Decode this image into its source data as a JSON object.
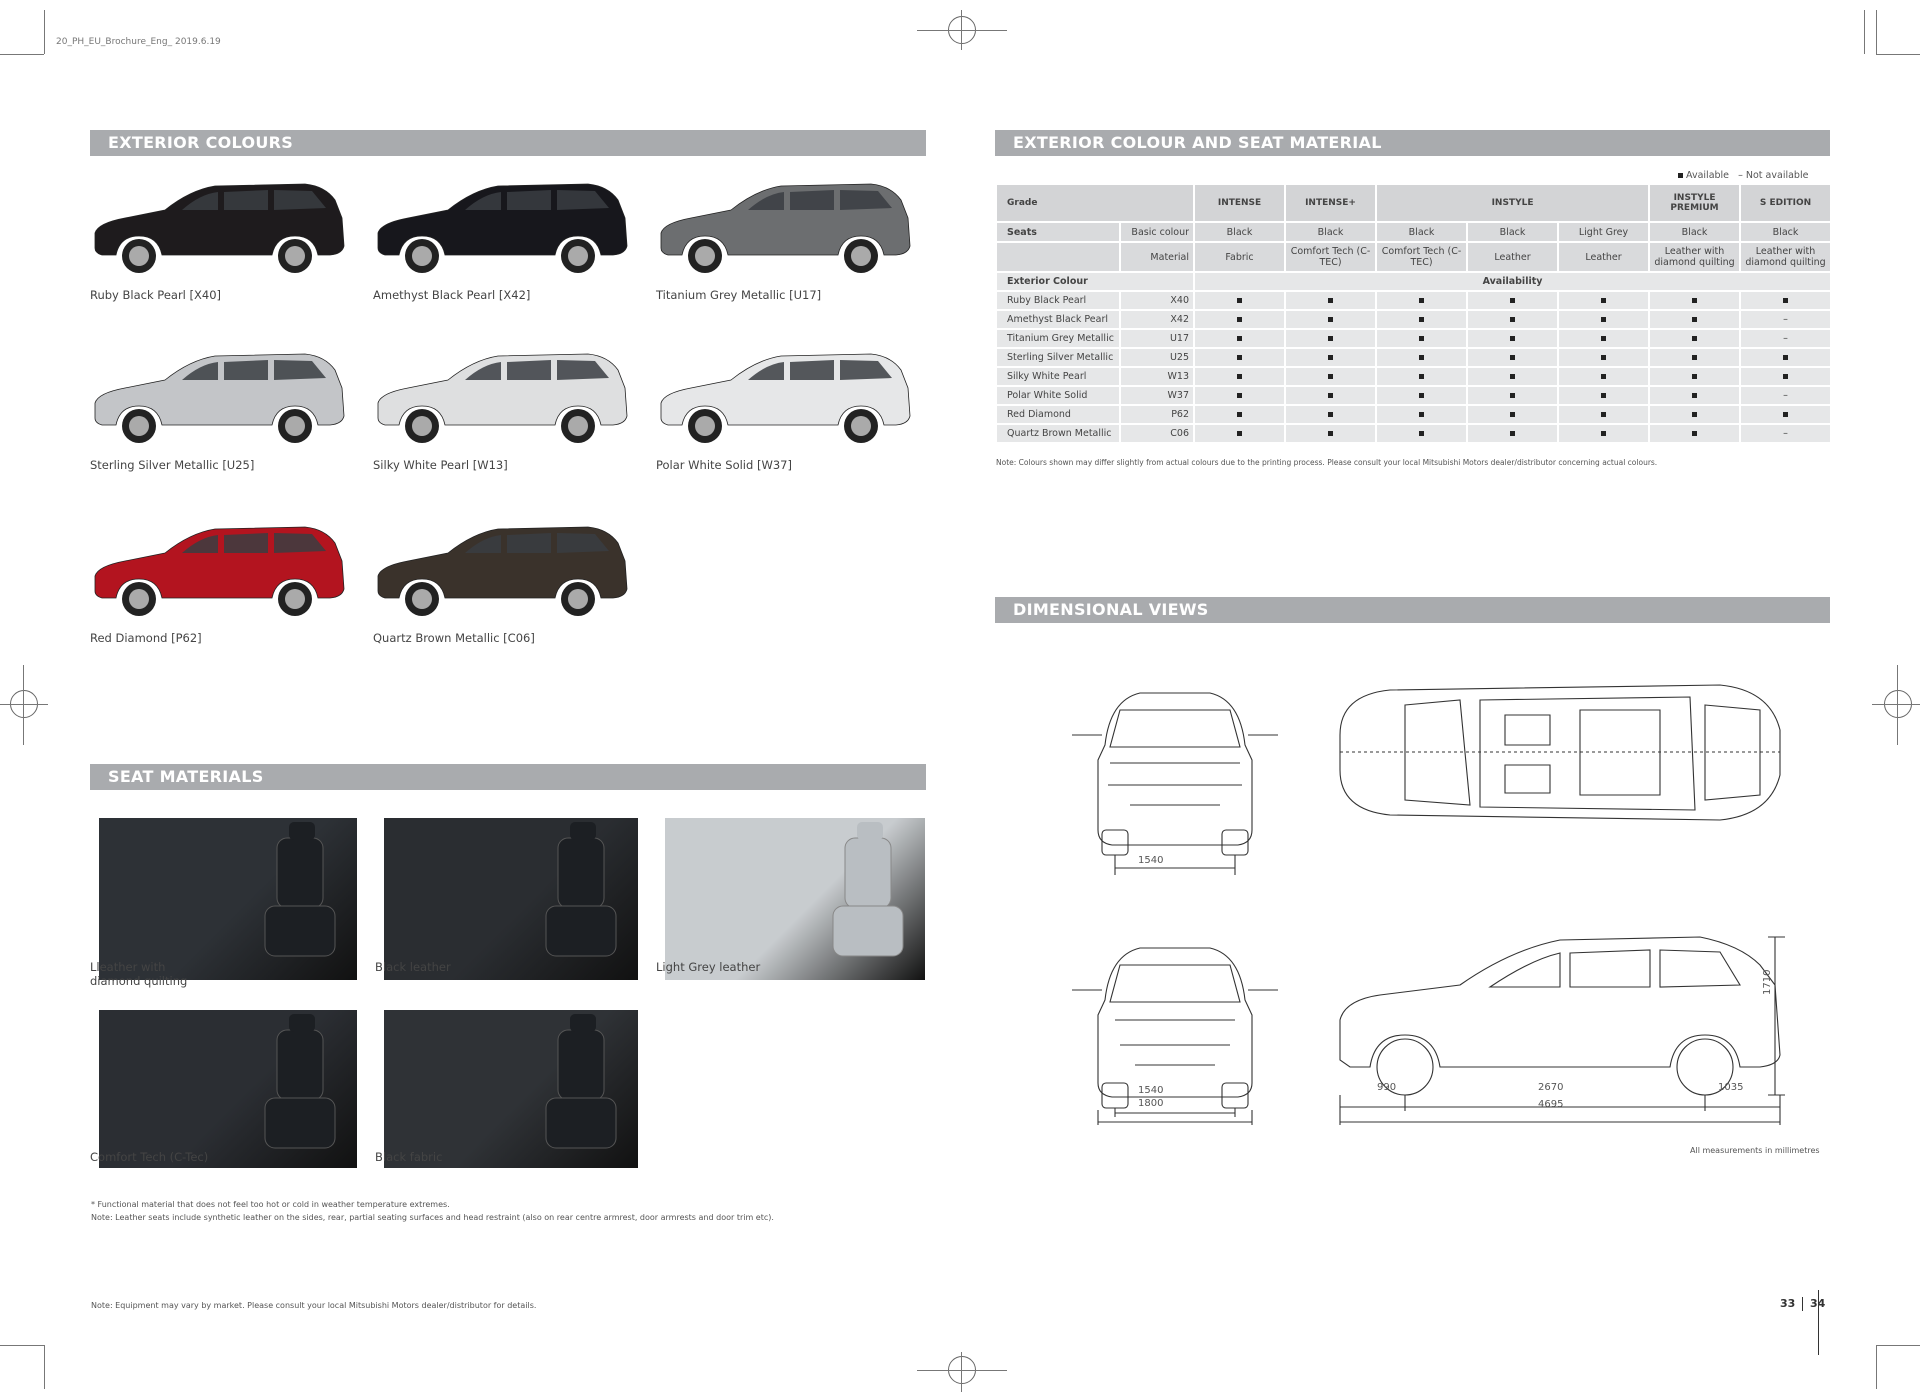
{
  "file_stamp": "20_PH_EU_Brochure_Eng_ 2019.6.19",
  "left": {
    "exterior_title": "EXTERIOR COLOURS",
    "cars": [
      {
        "caption": "Ruby Black Pearl [X40]",
        "color": "#1e1b1d"
      },
      {
        "caption": "Amethyst Black Pearl [X42]",
        "color": "#17171c"
      },
      {
        "caption": "Titanium Grey Metallic [U17]",
        "color": "#6c6e70"
      },
      {
        "caption": "Sterling Silver Metallic [U25]",
        "color": "#c3c5c8"
      },
      {
        "caption": "Silky White Pearl [W13]",
        "color": "#dedfe0"
      },
      {
        "caption": "Polar White Solid [W37]",
        "color": "#e6e7e8"
      },
      {
        "caption": "Red Diamond [P62]",
        "color": "#b3141f"
      },
      {
        "caption": "Quartz Brown Metallic [C06]",
        "color": "#3a322b"
      }
    ],
    "seat_title": "SEAT MATERIALS",
    "seats": [
      {
        "caption": "Lleather with\ndiamond quilting",
        "color": "#2d3136"
      },
      {
        "caption": "Black leather",
        "color": "#2a2d31"
      },
      {
        "caption": "Light Grey leather",
        "color": "#c8cccf"
      },
      {
        "caption": "Comfort Tech (C-Tec)",
        "color": "#2b2e33"
      },
      {
        "caption": "Black fabric",
        "color": "#2f3236"
      }
    ],
    "footnote1": "* Functional material that does not feel too hot or cold in weather temperature extremes.",
    "footnote2": "Note: Leather seats include synthetic leather on the sides, rear, partial seating surfaces and head restraint (also on rear centre armrest, door armrests and door trim etc).",
    "bottom_note": "Note: Equipment may vary by market. Please consult your local Mitsubishi Motors dealer/distributor for details."
  },
  "right": {
    "table_title": "EXTERIOR COLOUR AND SEAT MATERIAL",
    "legend_available": "Available",
    "legend_not": "Not available",
    "grade_label": "Grade",
    "grades": [
      "INTENSE",
      "INTENSE+",
      "INSTYLE",
      "INSTYLE PREMIUM",
      "S EDITION"
    ],
    "seats_label": "Seats",
    "basic_colour_label": "Basic colour",
    "material_label": "Material",
    "basic_colours": [
      "Black",
      "Black",
      "Black",
      "Black",
      "Light Grey",
      "Black",
      "Black"
    ],
    "materials": [
      "Fabric",
      "Comfort Tech (C-TEC)",
      "Comfort Tech (C-TEC)",
      "Leather",
      "Leather",
      "Leather with diamond quilting",
      "Leather with diamond quilting"
    ],
    "exterior_colour_label": "Exterior Colour",
    "availability_label": "Availability",
    "rows": [
      {
        "name": "Ruby Black Pearl",
        "code": "X40",
        "avail": [
          1,
          1,
          1,
          1,
          1,
          1,
          1
        ]
      },
      {
        "name": "Amethyst Black Pearl",
        "code": "X42",
        "avail": [
          1,
          1,
          1,
          1,
          1,
          1,
          0
        ]
      },
      {
        "name": "Titanium Grey Metallic",
        "code": "U17",
        "avail": [
          1,
          1,
          1,
          1,
          1,
          1,
          0
        ]
      },
      {
        "name": "Sterling Silver Metallic",
        "code": "U25",
        "avail": [
          1,
          1,
          1,
          1,
          1,
          1,
          1
        ]
      },
      {
        "name": "Silky White Pearl",
        "code": "W13",
        "avail": [
          1,
          1,
          1,
          1,
          1,
          1,
          1
        ]
      },
      {
        "name": "Polar White Solid",
        "code": "W37",
        "avail": [
          1,
          1,
          1,
          1,
          1,
          1,
          0
        ]
      },
      {
        "name": "Red Diamond",
        "code": "P62",
        "avail": [
          1,
          1,
          1,
          1,
          1,
          1,
          1
        ]
      },
      {
        "name": "Quartz Brown Metallic",
        "code": "C06",
        "avail": [
          1,
          1,
          1,
          1,
          1,
          1,
          0
        ]
      }
    ],
    "table_note": "Note: Colours shown may differ slightly from actual colours due to the printing process. Please consult your local Mitsubishi Motors dealer/distributor concerning actual colours.",
    "dim_title": "DIMENSIONAL VIEWS",
    "dims": {
      "rear_track": "1540",
      "front_track": "1540",
      "width": "1800",
      "front_overhang": "990",
      "wheelbase": "2670",
      "rear_overhang": "1035",
      "length": "4695",
      "height": "1710"
    },
    "dim_note": "All measurements in millimetres",
    "page_left": "33",
    "page_right": "34"
  }
}
